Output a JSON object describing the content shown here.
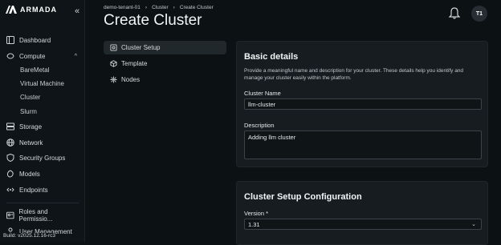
{
  "brand": {
    "name": "ARMADA",
    "collapse_icon": "double-chevron-left-icon"
  },
  "sidebar": {
    "items": [
      {
        "label": "Dashboard",
        "icon": "dashboard-icon"
      },
      {
        "label": "Compute",
        "icon": "compute-icon",
        "expanded": true,
        "children": [
          "BareMetal",
          "Virtual Machine",
          "Cluster",
          "Slurm"
        ]
      },
      {
        "label": "Storage",
        "icon": "storage-icon"
      },
      {
        "label": "Network",
        "icon": "network-icon"
      },
      {
        "label": "Security Groups",
        "icon": "shield-icon"
      },
      {
        "label": "Models",
        "icon": "models-icon"
      },
      {
        "label": "Endpoints",
        "icon": "endpoints-icon"
      },
      {
        "label": "Roles and Permissio...",
        "icon": "roles-icon"
      },
      {
        "label": "User Management",
        "icon": "users-icon"
      }
    ],
    "build": "Build: v2025.12.16-rc3"
  },
  "header": {
    "breadcrumb": [
      "demo-tenant-01",
      "Cluster",
      "Create Cluster"
    ],
    "title": "Create Cluster",
    "avatar_initials": "T1"
  },
  "steps": [
    {
      "label": "Cluster Setup",
      "icon": "settings-icon",
      "active": true
    },
    {
      "label": "Template",
      "icon": "cube-icon",
      "active": false
    },
    {
      "label": "Nodes",
      "icon": "nodes-icon",
      "active": false
    }
  ],
  "basic_details": {
    "title": "Basic details",
    "description": "Provide a meaningful name and description for your cluster. These details help you identify and manage your cluster easily within the platform.",
    "name_label": "Cluster Name",
    "name_value": "llm-cluster",
    "desc_label": "Description",
    "desc_value": "Adding llm cluster"
  },
  "setup_config": {
    "title": "Cluster Setup Configuration",
    "version_label": "Version *",
    "version_value": "1.31"
  }
}
